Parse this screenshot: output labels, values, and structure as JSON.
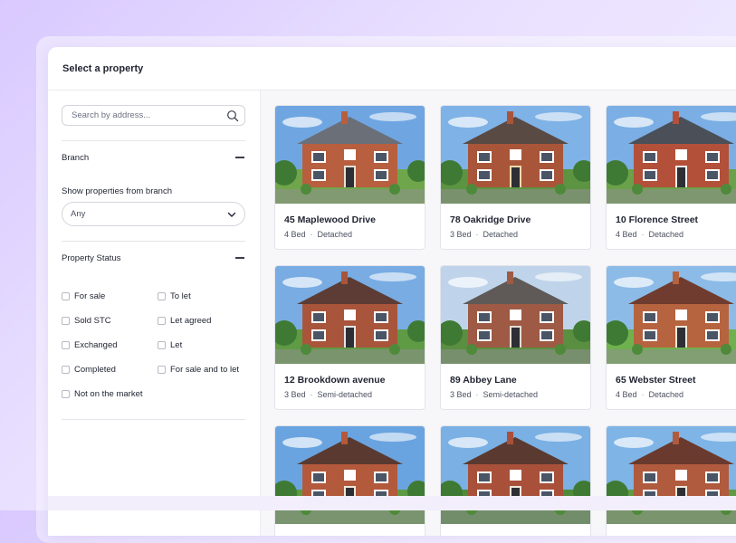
{
  "dialog": {
    "title": "Select a property"
  },
  "sidebar": {
    "search": {
      "placeholder": "Search by address..."
    },
    "branch": {
      "heading": "Branch",
      "label": "Show properties from branch",
      "selected": "Any"
    },
    "status": {
      "heading": "Property Status",
      "options": [
        {
          "label": "For sale",
          "checked": false
        },
        {
          "label": "To let",
          "checked": false
        },
        {
          "label": "Sold STC",
          "checked": false
        },
        {
          "label": "Let agreed",
          "checked": false
        },
        {
          "label": "Exchanged",
          "checked": false
        },
        {
          "label": "Let",
          "checked": false
        },
        {
          "label": "Completed",
          "checked": false
        },
        {
          "label": "For sale and to let",
          "checked": false
        },
        {
          "label": "Not on the market",
          "checked": false
        }
      ]
    }
  },
  "properties": [
    {
      "address": "45 Maplewood Drive",
      "beds": "4 Bed",
      "type": "Detached"
    },
    {
      "address": "78 Oakridge Drive",
      "beds": "3 Bed",
      "type": "Detached"
    },
    {
      "address": "10 Florence Street",
      "beds": "4 Bed",
      "type": "Detached"
    },
    {
      "address": "12 Brookdown avenue",
      "beds": "3 Bed",
      "type": "Semi-detached"
    },
    {
      "address": "89 Abbey Lane",
      "beds": "3 Bed",
      "type": "Semi-detached"
    },
    {
      "address": "65 Webster Street",
      "beds": "4 Bed",
      "type": "Detached"
    },
    {
      "address": "",
      "beds": "",
      "type": ""
    },
    {
      "address": "",
      "beds": "",
      "type": ""
    },
    {
      "address": "",
      "beds": "",
      "type": ""
    }
  ],
  "icons": {
    "search": "search-icon",
    "collapse": "minus-icon",
    "dropdown": "chevron-down-icon"
  }
}
